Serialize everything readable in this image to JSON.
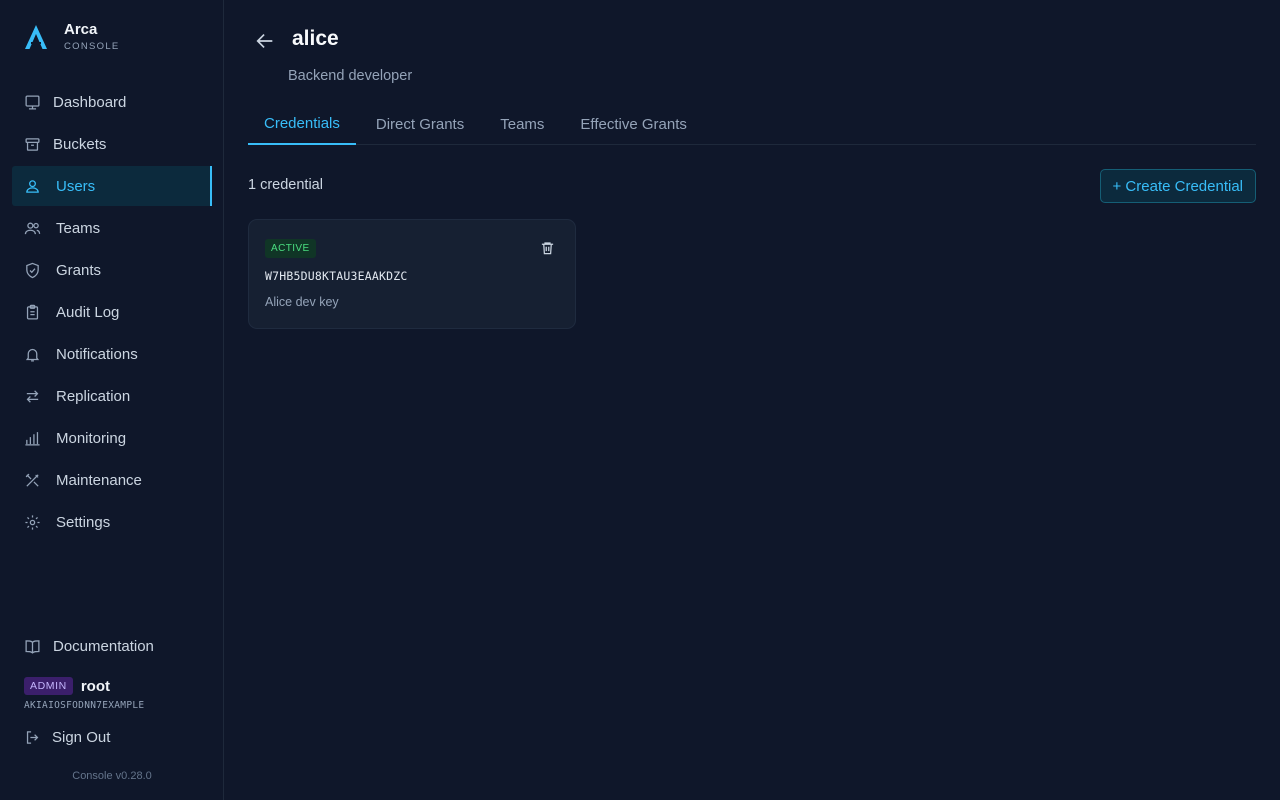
{
  "brand": {
    "name": "Arca",
    "subtitle": "CONSOLE",
    "accent": "#38bdf8"
  },
  "sidebar": {
    "items": [
      {
        "label": "Dashboard",
        "icon": "monitor-icon"
      },
      {
        "label": "Buckets",
        "icon": "archive-icon"
      },
      {
        "label": "Users",
        "icon": "user-icon",
        "active": true
      },
      {
        "label": "Teams",
        "icon": "users-icon"
      },
      {
        "label": "Grants",
        "icon": "shield-check-icon"
      },
      {
        "label": "Audit Log",
        "icon": "clipboard-icon"
      },
      {
        "label": "Notifications",
        "icon": "bell-icon"
      },
      {
        "label": "Replication",
        "icon": "arrows-swap-icon"
      },
      {
        "label": "Monitoring",
        "icon": "bar-chart-icon"
      },
      {
        "label": "Maintenance",
        "icon": "tools-icon"
      },
      {
        "label": "Settings",
        "icon": "gear-icon"
      }
    ],
    "documentation_label": "Documentation",
    "admin_badge": "ADMIN",
    "admin_user": "root",
    "admin_access_key": "AKIAIOSFODNN7EXAMPLE",
    "signout_label": "Sign Out",
    "version": "Console v0.28.0"
  },
  "page": {
    "title": "alice",
    "description": "Backend developer"
  },
  "tabs": [
    {
      "label": "Credentials",
      "active": true
    },
    {
      "label": "Direct Grants"
    },
    {
      "label": "Teams"
    },
    {
      "label": "Effective Grants"
    }
  ],
  "credentials": {
    "count_label": "1 credential",
    "create_label": "+ Create Credential",
    "items": [
      {
        "status": "ACTIVE",
        "status_color": "#4ade80",
        "key_id": "W7HB5DU8KTAU3EAAKDZC",
        "description": "Alice dev key"
      }
    ]
  }
}
